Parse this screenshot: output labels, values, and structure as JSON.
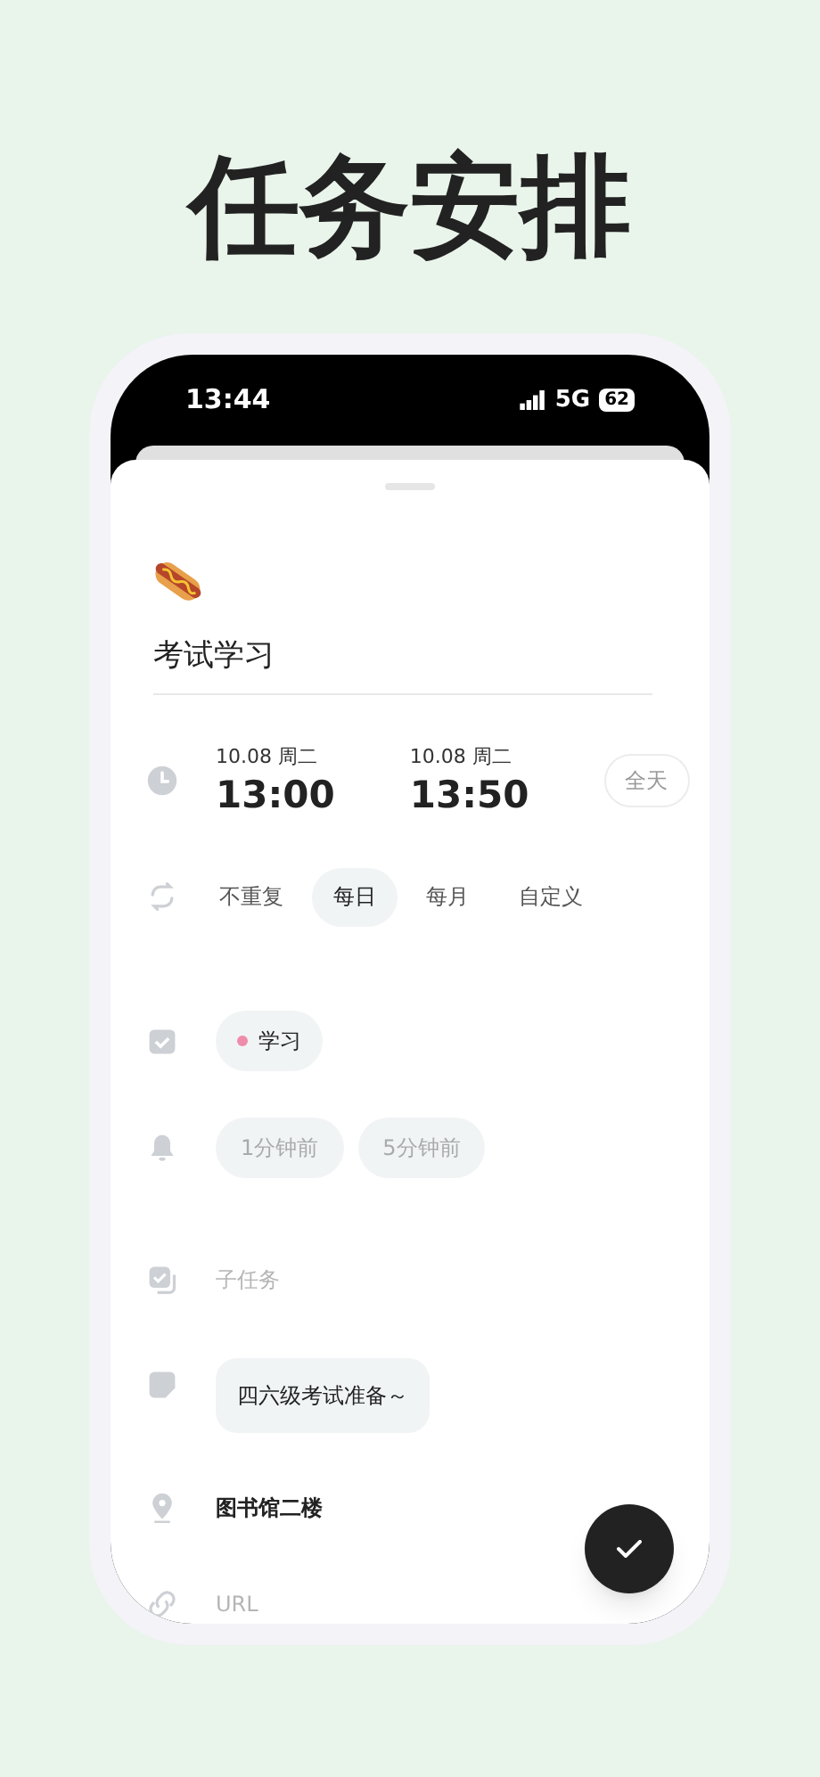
{
  "headline": "任务安排",
  "status_bar": {
    "time": "13:44",
    "network": "5G",
    "battery": "62"
  },
  "task": {
    "title": "考试学习",
    "start": {
      "date": "10.08 周二",
      "time": "13:00"
    },
    "end": {
      "date": "10.08 周二",
      "time": "13:50"
    },
    "all_day": {
      "label": "全天",
      "on": false
    },
    "repeat": [
      {
        "label": "不重复",
        "selected": false
      },
      {
        "label": "每日",
        "selected": true
      },
      {
        "label": "每月",
        "selected": false
      },
      {
        "label": "自定义",
        "selected": false
      }
    ],
    "tags": [
      {
        "label": "学习",
        "color": "#f08cab"
      }
    ],
    "reminders": [
      "1分钟前",
      "5分钟前"
    ],
    "subtask": {
      "placeholder": "子任务"
    },
    "note": "四六级考试准备～",
    "location": "图书馆二楼",
    "url": {
      "placeholder": "URL"
    }
  }
}
